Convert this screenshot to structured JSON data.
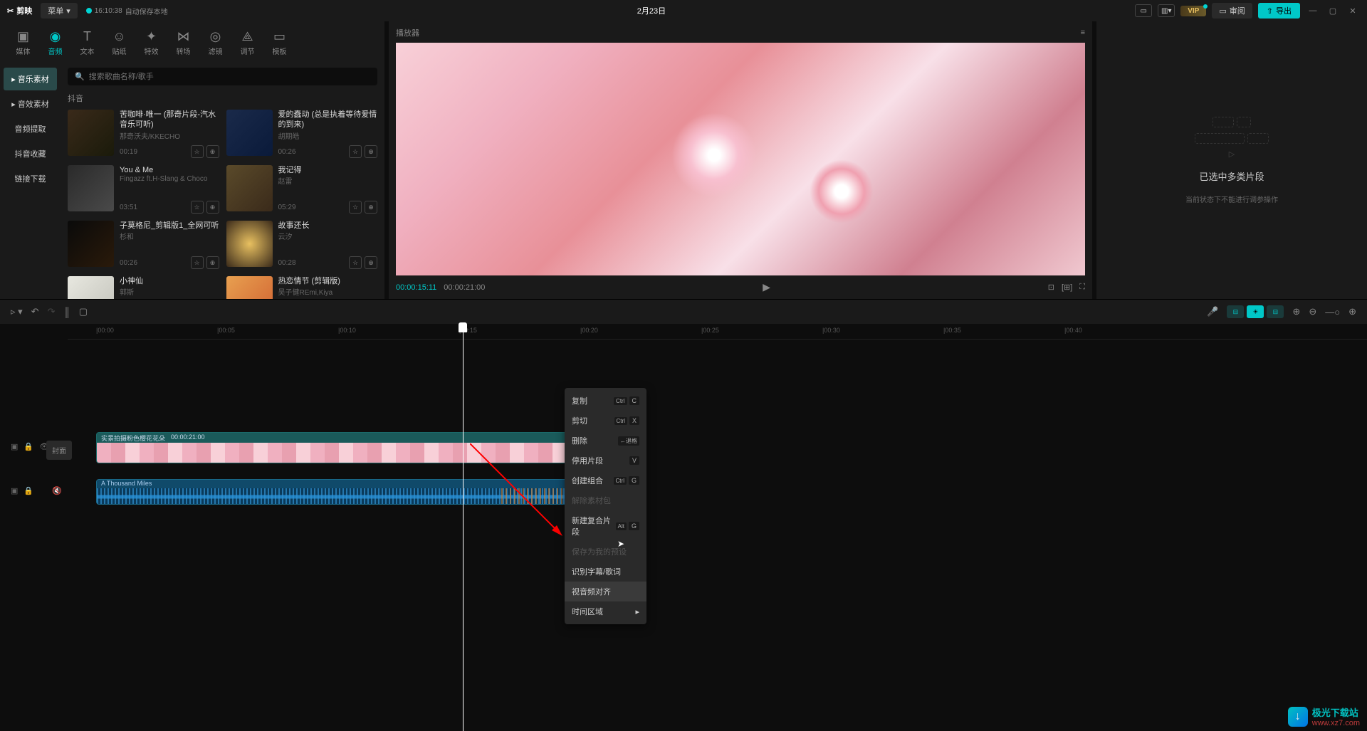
{
  "topbar": {
    "app": "剪映",
    "menu": "菜单",
    "save_time": "16:10:38",
    "save_text": "自动保存本地",
    "title": "2月23日",
    "review": "审阅",
    "export": "导出",
    "vip": "VIP"
  },
  "tabs": [
    {
      "icon": "▣",
      "label": "媒体"
    },
    {
      "icon": "◉",
      "label": "音频"
    },
    {
      "icon": "T",
      "label": "文本"
    },
    {
      "icon": "☺",
      "label": "贴纸"
    },
    {
      "icon": "✦",
      "label": "特效"
    },
    {
      "icon": "⋈",
      "label": "转场"
    },
    {
      "icon": "◎",
      "label": "滤镜"
    },
    {
      "icon": "⟁",
      "label": "调节"
    },
    {
      "icon": "▭",
      "label": "模板"
    }
  ],
  "sidebar": {
    "items": [
      "音乐素材",
      "音效素材",
      "音频提取",
      "抖音收藏",
      "链接下载"
    ]
  },
  "search": {
    "placeholder": "搜索歌曲名称/歌手"
  },
  "section": "抖音",
  "music": [
    {
      "title": "苦咖啡·唯一 (那奇片段-汽水音乐可听)",
      "artist": "那奇沃夫/KKECHO",
      "dur": "00:19",
      "cover": "c1"
    },
    {
      "title": "爱的蠢动 (总是执着等待爱情的到来)",
      "artist": "胡期皓",
      "dur": "00:26",
      "cover": "c2"
    },
    {
      "title": "You & Me",
      "artist": "Fingazz ft.H-Slang & Choco",
      "dur": "03:51",
      "cover": "c3"
    },
    {
      "title": "我记得",
      "artist": "赵雷",
      "dur": "05:29",
      "cover": "c4"
    },
    {
      "title": "子莫格尼_剪辑版1_全网可听",
      "artist": "杉和",
      "dur": "00:26",
      "cover": "c5"
    },
    {
      "title": "故事还长",
      "artist": "云汐",
      "dur": "00:28",
      "cover": "c6"
    },
    {
      "title": "小神仙",
      "artist": "郭斯",
      "dur": "",
      "cover": "c7"
    },
    {
      "title": "热恋情节 (剪辑版)",
      "artist": "吴子健REmi,Kiya",
      "dur": "",
      "cover": "c8"
    }
  ],
  "player": {
    "title": "播放器",
    "cur": "00:00:15:11",
    "total": "00:00:21:00"
  },
  "right_panel": {
    "title": "已选中多类片段",
    "sub": "当前状态下不能进行调参操作"
  },
  "ruler": [
    "00:00",
    "00:05",
    "00:10",
    "00:15",
    "00:20",
    "00:25",
    "00:30",
    "00:35",
    "00:40"
  ],
  "timeline": {
    "cover": "封面",
    "video_clip": "实景拍摄粉色樱花花朵",
    "video_dur": "00:00:21:00",
    "audio_clip": "A Thousand Miles"
  },
  "context_menu": [
    {
      "label": "复制",
      "keys": [
        "Ctrl",
        "C"
      ]
    },
    {
      "label": "剪切",
      "keys": [
        "Ctrl",
        "X"
      ]
    },
    {
      "label": "删除",
      "keys": [
        "←退格"
      ]
    },
    {
      "label": "停用片段",
      "keys": [
        "V"
      ]
    },
    {
      "label": "创建组合",
      "keys": [
        "Ctrl",
        "G"
      ]
    },
    {
      "label": "解除素材包",
      "disabled": true
    },
    {
      "label": "新建复合片段",
      "keys": [
        "Alt",
        "G"
      ]
    },
    {
      "label": "保存为我的预设",
      "disabled": true
    },
    {
      "label": "识别字幕/歌词"
    },
    {
      "label": "视音频对齐",
      "hover": true
    },
    {
      "label": "时间区域",
      "sub": true
    }
  ],
  "watermark": {
    "text": "极光下载站",
    "url": "www.xz7.com"
  }
}
